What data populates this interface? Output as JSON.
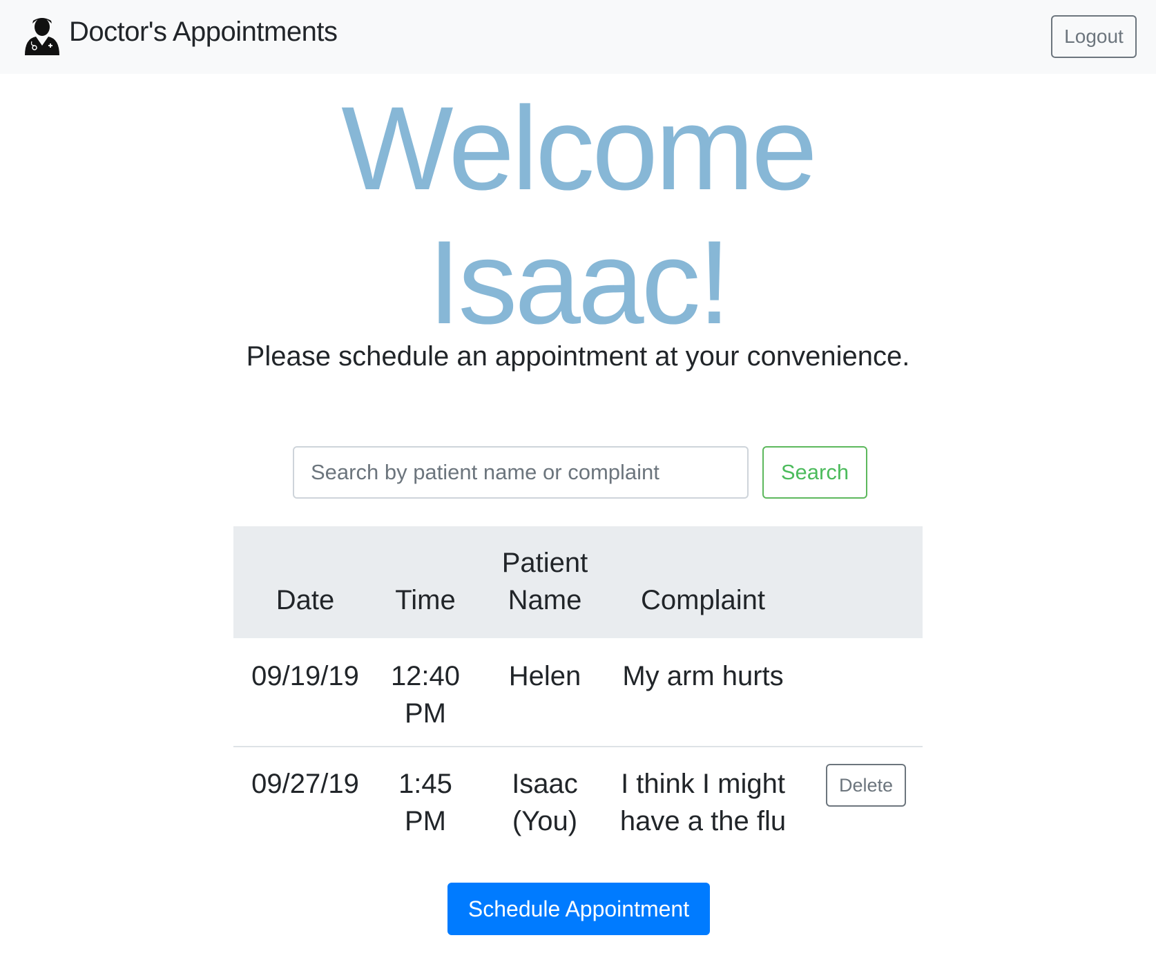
{
  "navbar": {
    "brand_icon": "doctor-icon",
    "brand_title": "Doctor's Appointments",
    "logout_label": "Logout"
  },
  "hero": {
    "welcome_line1": "Welcome",
    "welcome_line2": "Isaac!",
    "subtitle": "Please schedule an appointment at your convenience."
  },
  "search": {
    "placeholder": "Search by patient name or complaint",
    "button_label": "Search"
  },
  "table": {
    "headers": {
      "date": "Date",
      "time": "Time",
      "patient_name_line1": "Patient",
      "patient_name_line2": "Name",
      "complaint": "Complaint"
    },
    "rows": [
      {
        "date": "09/19/19",
        "time_line1": "12:40",
        "time_line2": "PM",
        "patient_line1": "Helen",
        "patient_line2": "",
        "complaint_line1": "My arm hurts",
        "complaint_line2": ""
      },
      {
        "date": "09/27/19",
        "time_line1": "1:45",
        "time_line2": "PM",
        "patient_line1": "Isaac",
        "patient_line2": "(You)",
        "complaint_line1": "I think I might",
        "complaint_line2": "have a the flu",
        "delete_label": "Delete"
      }
    ]
  },
  "schedule_button_label": "Schedule Appointment",
  "colors": {
    "welcome": "#87b7d6",
    "navbar_bg": "#f8f9fa",
    "table_header_bg": "#e9ecef",
    "success": "#5cb85c",
    "primary": "#007bff",
    "secondary": "#6c757d"
  }
}
